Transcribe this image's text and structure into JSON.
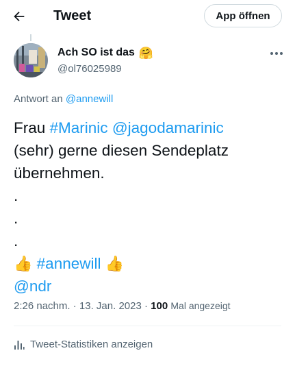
{
  "header": {
    "title": "Tweet",
    "back_icon": "arrow-left-icon",
    "app_button_label": "App öffnen"
  },
  "author": {
    "display_name": "Ach SO ist das",
    "name_emoji": "🤗",
    "handle": "@ol76025989"
  },
  "reply": {
    "prefix": "Antwort an ",
    "mention": "@annewill"
  },
  "tweet": {
    "line1_prefix": "Frau ",
    "hashtag1": "#Marinic",
    "mention1": "@jagodamarinic",
    "line2": "(sehr) gerne diesen Sendeplatz",
    "line3": "übernehmen.",
    "dot": ".",
    "thumbs_emoji": "👍",
    "hashtag2": "#annewill",
    "mention2": "@ndr"
  },
  "meta": {
    "time": "2:26 nachm.",
    "separator": "·",
    "date": "13. Jan. 2023",
    "views": "100",
    "views_label": "Mal angezeigt"
  },
  "stats": {
    "label": "Tweet-Statistiken anzeigen",
    "icon": "bar-chart-icon"
  },
  "colors": {
    "link": "#1d9bf0",
    "text": "#0f1419",
    "secondary": "#536471",
    "border": "#cfd9de"
  }
}
